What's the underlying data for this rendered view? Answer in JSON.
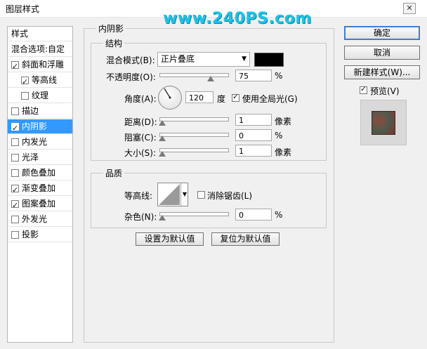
{
  "window": {
    "title": "图层样式",
    "watermark": "www.240PS.com",
    "close_glyph": "✕"
  },
  "left_panel": {
    "header": "样式",
    "blend_options": "混合选项:自定",
    "items": [
      {
        "label": "斜面和浮雕",
        "checked": true
      },
      {
        "label": "等高线",
        "checked": true
      },
      {
        "label": "纹理",
        "checked": false
      },
      {
        "label": "描边",
        "checked": false
      },
      {
        "label": "内阴影",
        "checked": true,
        "selected": true
      },
      {
        "label": "内发光",
        "checked": false
      },
      {
        "label": "光泽",
        "checked": false
      },
      {
        "label": "颜色叠加",
        "checked": false
      },
      {
        "label": "渐变叠加",
        "checked": true
      },
      {
        "label": "图案叠加",
        "checked": true
      },
      {
        "label": "外发光",
        "checked": false
      },
      {
        "label": "投影",
        "checked": false
      }
    ]
  },
  "main": {
    "section_title": "内阴影",
    "structure": {
      "title": "结构",
      "blend_mode_label": "混合模式(B):",
      "blend_mode_value": "正片叠底",
      "color_swatch": "#000000",
      "opacity_label": "不透明度(O):",
      "opacity_value": "75",
      "opacity_unit": "%",
      "opacity_level": 0.75,
      "angle_label": "角度(A):",
      "angle_value": "120",
      "angle_unit": "度",
      "global_light_label": "使用全局光(G)",
      "global_light_checked": true,
      "distance_label": "距离(D):",
      "distance_value": "1",
      "distance_unit": "像素",
      "choke_label": "阻塞(C):",
      "choke_value": "0",
      "choke_unit": "%",
      "size_label": "大小(S):",
      "size_value": "1",
      "size_unit": "像素"
    },
    "quality": {
      "title": "品质",
      "contour_label": "等高线:",
      "antialias_label": "消除锯齿(L)",
      "antialias_checked": false,
      "noise_label": "杂色(N):",
      "noise_value": "0",
      "noise_unit": "%"
    },
    "set_default": "设置为默认值",
    "reset_default": "复位为默认值"
  },
  "right": {
    "ok": "确定",
    "cancel": "取消",
    "new_style": "新建样式(W)...",
    "preview_label": "预览(V)",
    "preview_checked": true
  },
  "colors": {
    "accent": "#3399ff",
    "watermark": "#1ec3e8"
  }
}
